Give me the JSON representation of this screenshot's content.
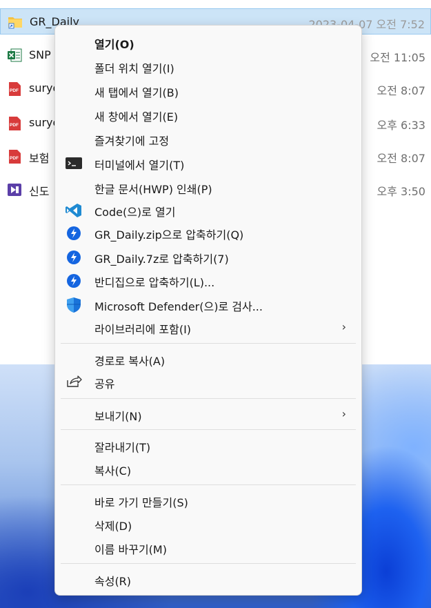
{
  "explorer": {
    "files": [
      {
        "name": "GR_Daily",
        "date": "2023-04-07 오전 7:52",
        "icon": "folder-shortcut-icon",
        "selected": true
      },
      {
        "name": "SNP",
        "date": "오전 11:05",
        "icon": "excel-icon"
      },
      {
        "name": "suryo",
        "date": "오전 8:07",
        "icon": "pdf-icon"
      },
      {
        "name": "suryo",
        "date": "오후 6:33",
        "icon": "pdf-icon"
      },
      {
        "name": "보험",
        "date": "오전 8:07",
        "icon": "pdf-icon"
      },
      {
        "name": "신도",
        "date": "오후 3:50",
        "icon": "video-icon"
      }
    ]
  },
  "menu": {
    "open": "열기(O)",
    "open_folder_location": "폴더 위치 열기(I)",
    "open_new_tab": "새 탭에서 열기(B)",
    "open_new_window": "새 창에서 열기(E)",
    "pin_favorites": "즐겨찾기에 고정",
    "open_terminal": "터미널에서 열기(T)",
    "print_hwp": "한글 문서(HWP) 인쇄(P)",
    "open_with_code": "Code(으)로 열기",
    "compress_zip": "GR_Daily.zip으로 압축하기(Q)",
    "compress_7z": "GR_Daily.7z로 압축하기(7)",
    "compress_bandizip": "반디집으로 압축하기(L)...",
    "scan_defender": "Microsoft Defender(으)로 검사...",
    "include_library": "라이브러리에 포함(I)",
    "copy_as_path": "경로로 복사(A)",
    "share": "공유",
    "send_to": "보내기(N)",
    "cut": "잘라내기(T)",
    "copy": "복사(C)",
    "create_shortcut": "바로 가기 만들기(S)",
    "delete": "삭제(D)",
    "rename": "이름 바꾸기(M)",
    "properties": "속성(R)",
    "submenu_arrow": "›"
  },
  "colors": {
    "selection": "#cce4f7",
    "menu_bg": "#f9f9f9",
    "bandizip_blue": "#1565e0",
    "vscode_blue": "#1f8ad2",
    "pdf_red": "#d83b3b",
    "excel_green": "#1d7a45",
    "folder_yellow": "#f4c143"
  }
}
